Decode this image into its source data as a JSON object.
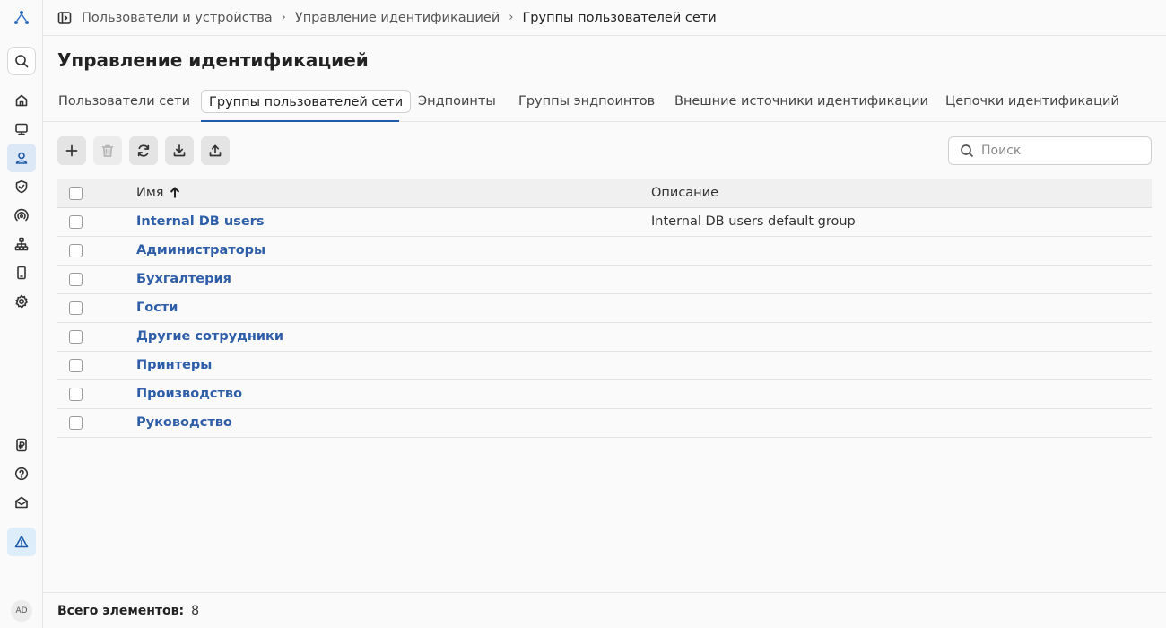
{
  "sidebar": {
    "items": [
      {
        "name": "logo-icon"
      },
      {
        "name": "search-icon"
      },
      {
        "name": "home-icon"
      },
      {
        "name": "monitor-icon"
      },
      {
        "name": "user-icon"
      },
      {
        "name": "shield-icon"
      },
      {
        "name": "wireless-icon"
      },
      {
        "name": "network-tree-icon"
      },
      {
        "name": "device-icon"
      },
      {
        "name": "settings-icon"
      },
      {
        "name": "license-icon"
      },
      {
        "name": "help-icon"
      },
      {
        "name": "mail-icon"
      },
      {
        "name": "alert-icon"
      }
    ],
    "avatar": "AD"
  },
  "breadcrumb": {
    "items": [
      "Пользователи и устройства",
      "Управление идентификацией",
      "Группы пользователей сети"
    ]
  },
  "page_title": "Управление идентификацией",
  "tabs": [
    {
      "label": "Пользователи сети",
      "active": false
    },
    {
      "label": "Группы пользователей сети",
      "active": true
    },
    {
      "label": "Эндпоинты",
      "active": false
    },
    {
      "label": "Группы эндпоинтов",
      "active": false
    },
    {
      "label": "Внешние источники идентификации",
      "active": false
    },
    {
      "label": "Цепочки идентификаций",
      "active": false
    }
  ],
  "toolbar": {
    "buttons": [
      {
        "name": "add-icon"
      },
      {
        "name": "delete-icon",
        "disabled": true
      },
      {
        "name": "refresh-icon"
      },
      {
        "name": "import-icon"
      },
      {
        "name": "export-icon"
      }
    ]
  },
  "search": {
    "placeholder": "Поиск",
    "value": ""
  },
  "table": {
    "columns": [
      "Имя",
      "Описание"
    ],
    "sort": {
      "column": "Имя",
      "direction": "asc"
    },
    "rows": [
      {
        "name": "Internal DB users",
        "description": "Internal DB users default group"
      },
      {
        "name": "Администраторы",
        "description": ""
      },
      {
        "name": "Бухгалтерия",
        "description": ""
      },
      {
        "name": "Гости",
        "description": ""
      },
      {
        "name": "Другие сотрудники",
        "description": ""
      },
      {
        "name": "Принтеры",
        "description": ""
      },
      {
        "name": "Производство",
        "description": ""
      },
      {
        "name": "Руководство",
        "description": ""
      }
    ]
  },
  "footer": {
    "total_label": "Всего элементов:",
    "total_value": "8"
  },
  "colors": {
    "accent": "#1f5aa8",
    "link": "#2f5ea8",
    "active_nav": "#dde8f7"
  }
}
